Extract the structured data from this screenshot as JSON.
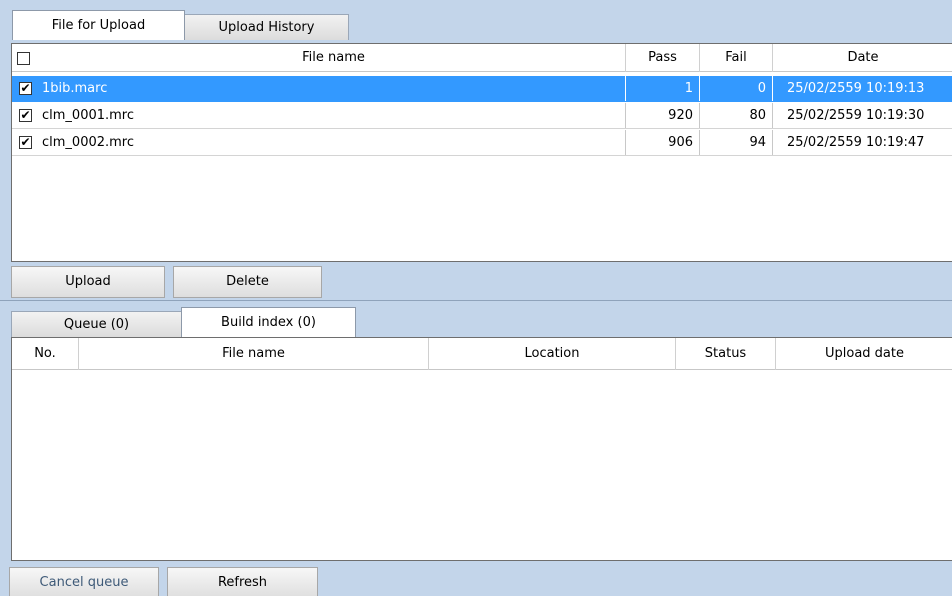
{
  "upload_tabs": [
    {
      "label": "File for Upload",
      "active": true
    },
    {
      "label": "Upload History",
      "active": false
    }
  ],
  "upload_grid": {
    "headers": {
      "file_name": "File name",
      "pass": "Pass",
      "fail": "Fail",
      "date": "Date"
    },
    "rows": [
      {
        "checked": true,
        "file_name": "1bib.marc",
        "pass": "1",
        "fail": "0",
        "date": "25/02/2559 10:19:13",
        "selected": true
      },
      {
        "checked": true,
        "file_name": "clm_0001.mrc",
        "pass": "920",
        "fail": "80",
        "date": "25/02/2559 10:19:30",
        "selected": false
      },
      {
        "checked": true,
        "file_name": "clm_0002.mrc",
        "pass": "906",
        "fail": "94",
        "date": "25/02/2559 10:19:47",
        "selected": false
      }
    ]
  },
  "upload_buttons": {
    "upload": "Upload",
    "delete": "Delete"
  },
  "queue_tabs": [
    {
      "label": "Queue (0)",
      "active": false
    },
    {
      "label": "Build index (0)",
      "active": true
    }
  ],
  "queue_grid": {
    "headers": {
      "no": "No.",
      "file_name": "File name",
      "location": "Location",
      "status": "Status",
      "upload_date": "Upload date"
    }
  },
  "queue_buttons": {
    "cancel_queue": "Cancel queue",
    "refresh": "Refresh"
  },
  "colors": {
    "selection": "#3399ff",
    "background": "#c3d5ea"
  }
}
